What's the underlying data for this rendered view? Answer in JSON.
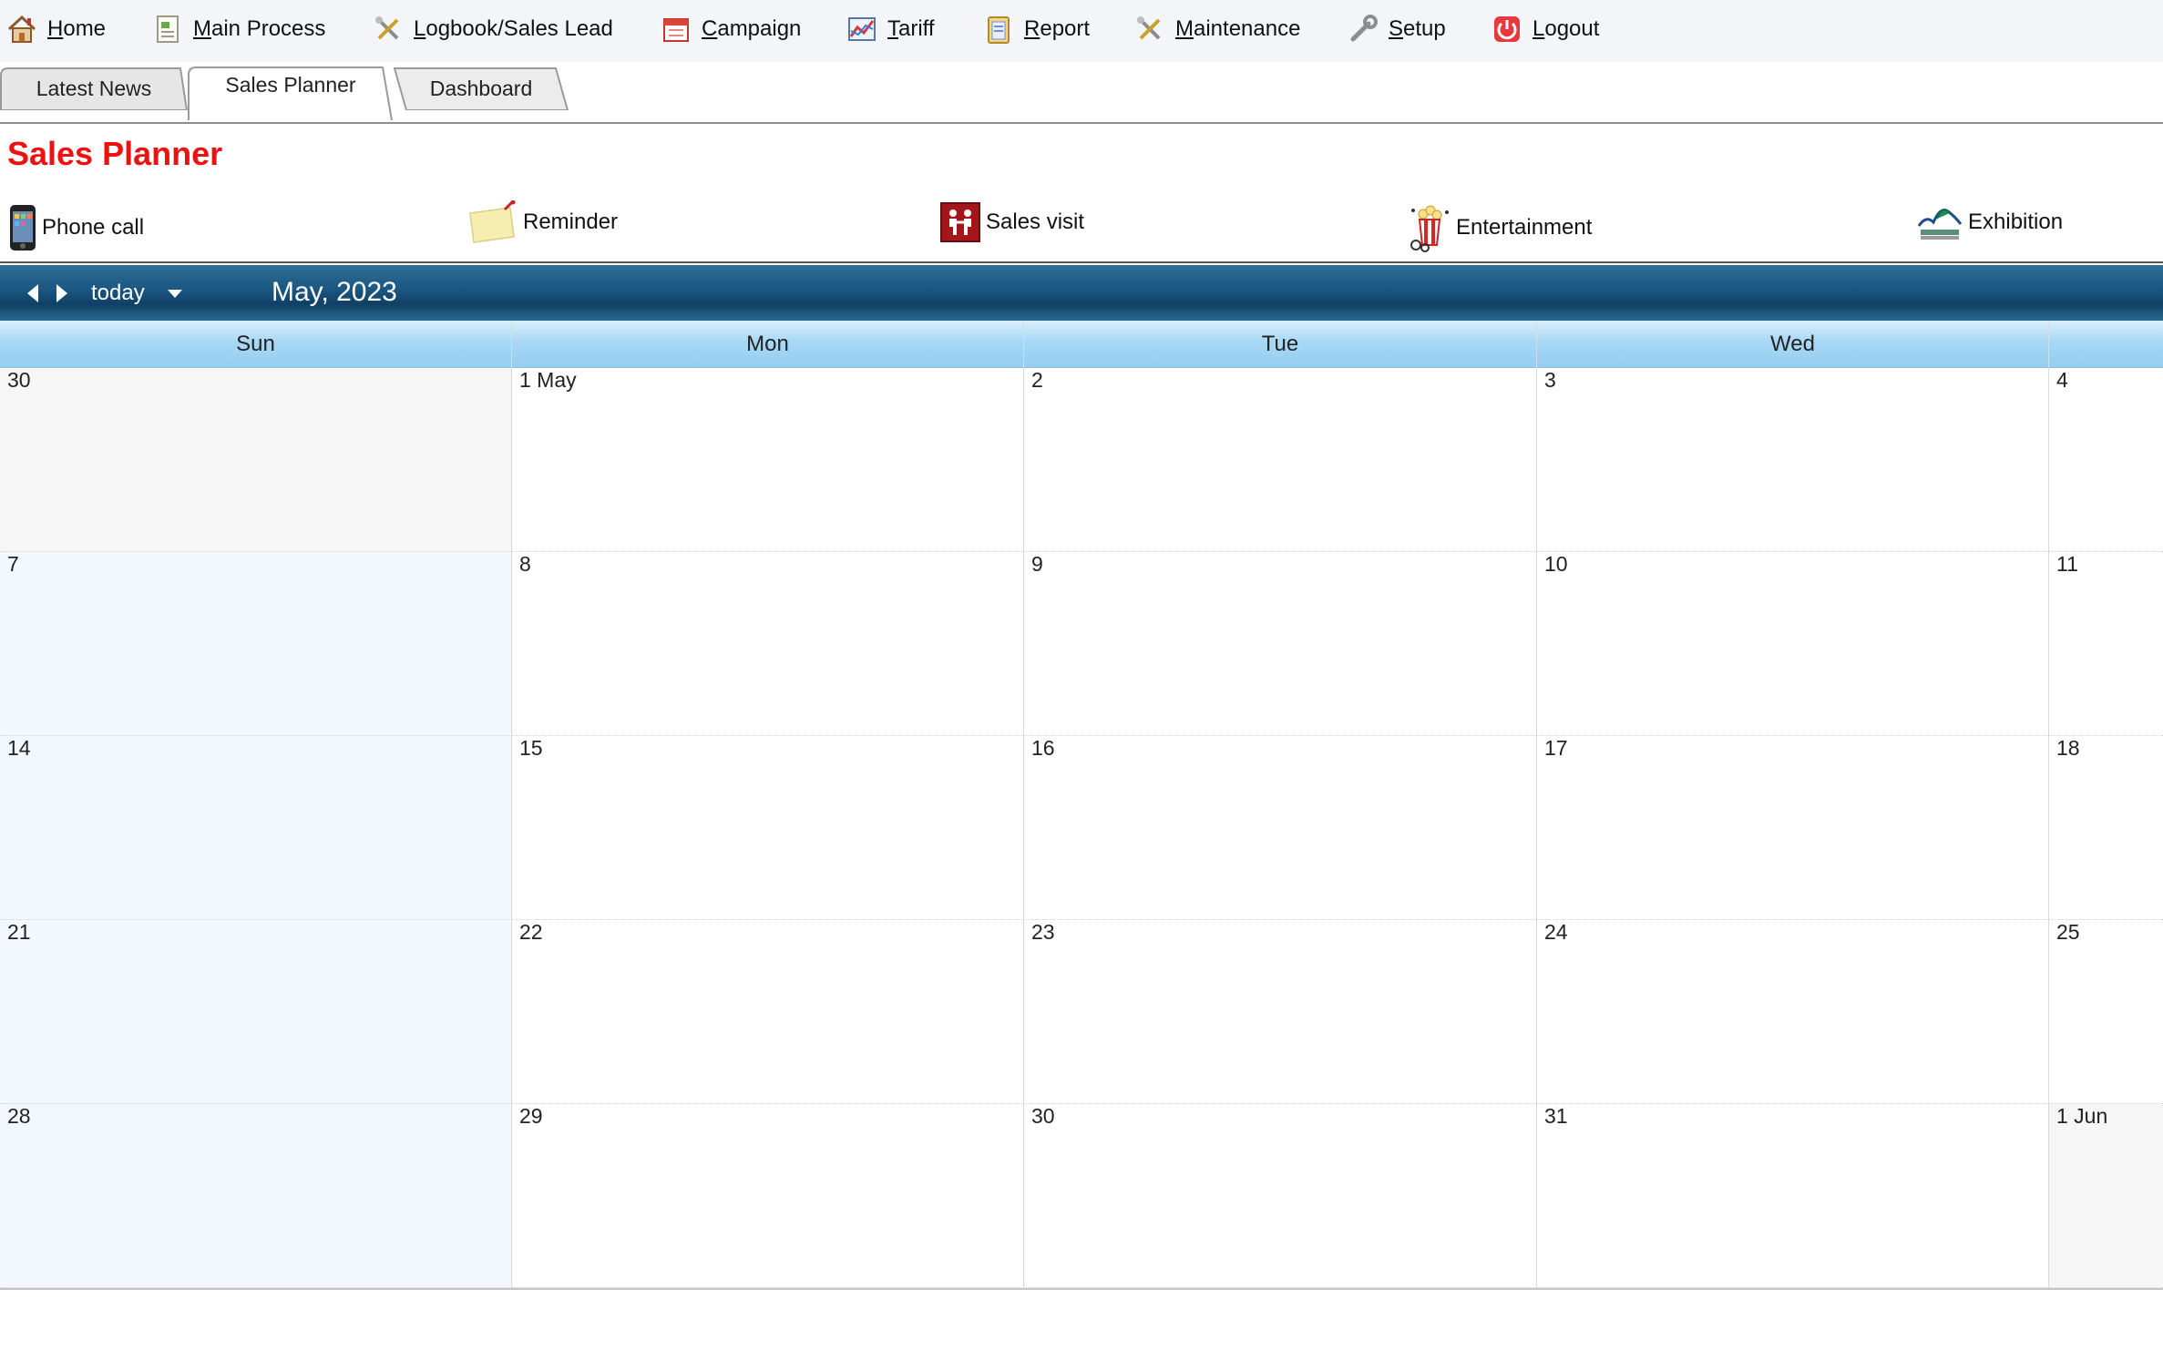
{
  "menu": [
    {
      "id": "home",
      "label": "Home",
      "icon": "house-icon"
    },
    {
      "id": "main-process",
      "label": "Main Process",
      "icon": "document-icon"
    },
    {
      "id": "logbook",
      "label": "Logbook/Sales Lead",
      "icon": "tools-icon"
    },
    {
      "id": "campaign",
      "label": "Campaign",
      "icon": "calendar-icon"
    },
    {
      "id": "tariff",
      "label": "Tariff",
      "icon": "chart-icon"
    },
    {
      "id": "report",
      "label": "Report",
      "icon": "clipboard-icon"
    },
    {
      "id": "maintenance",
      "label": "Maintenance",
      "icon": "tools-icon"
    },
    {
      "id": "setup",
      "label": "Setup",
      "icon": "wrench-icon"
    },
    {
      "id": "logout",
      "label": "Logout",
      "icon": "power-icon"
    }
  ],
  "tabs": [
    {
      "label": "Latest News",
      "active": false
    },
    {
      "label": "Sales Planner",
      "active": true
    },
    {
      "label": "Dashboard",
      "active": false
    }
  ],
  "page": {
    "title": "Sales Planner"
  },
  "legend": [
    {
      "label": "Phone call",
      "icon": "phone-icon"
    },
    {
      "label": "Reminder",
      "icon": "sticky-note-icon"
    },
    {
      "label": "Sales visit",
      "icon": "handshake-icon"
    },
    {
      "label": "Entertainment",
      "icon": "popcorn-icon"
    },
    {
      "label": "Exhibition",
      "icon": "exhibition-icon"
    }
  ],
  "calendar": {
    "today_label": "today",
    "month_title": "May, 2023",
    "weekdays": [
      "Sun",
      "Mon",
      "Tue",
      "Wed",
      ""
    ],
    "weeks": [
      [
        "30",
        "1 May",
        "2",
        "3",
        "4"
      ],
      [
        "7",
        "8",
        "9",
        "10",
        "11"
      ],
      [
        "14",
        "15",
        "16",
        "17",
        "18"
      ],
      [
        "21",
        "22",
        "23",
        "24",
        "25"
      ],
      [
        "28",
        "29",
        "30",
        "31",
        "1 Jun"
      ]
    ],
    "colors": {
      "sunday_bg": "#f2f8fd",
      "other_month_bg": "#f6f6f6",
      "toolbar": "#1b5680",
      "title_red": "#ee1111"
    }
  }
}
